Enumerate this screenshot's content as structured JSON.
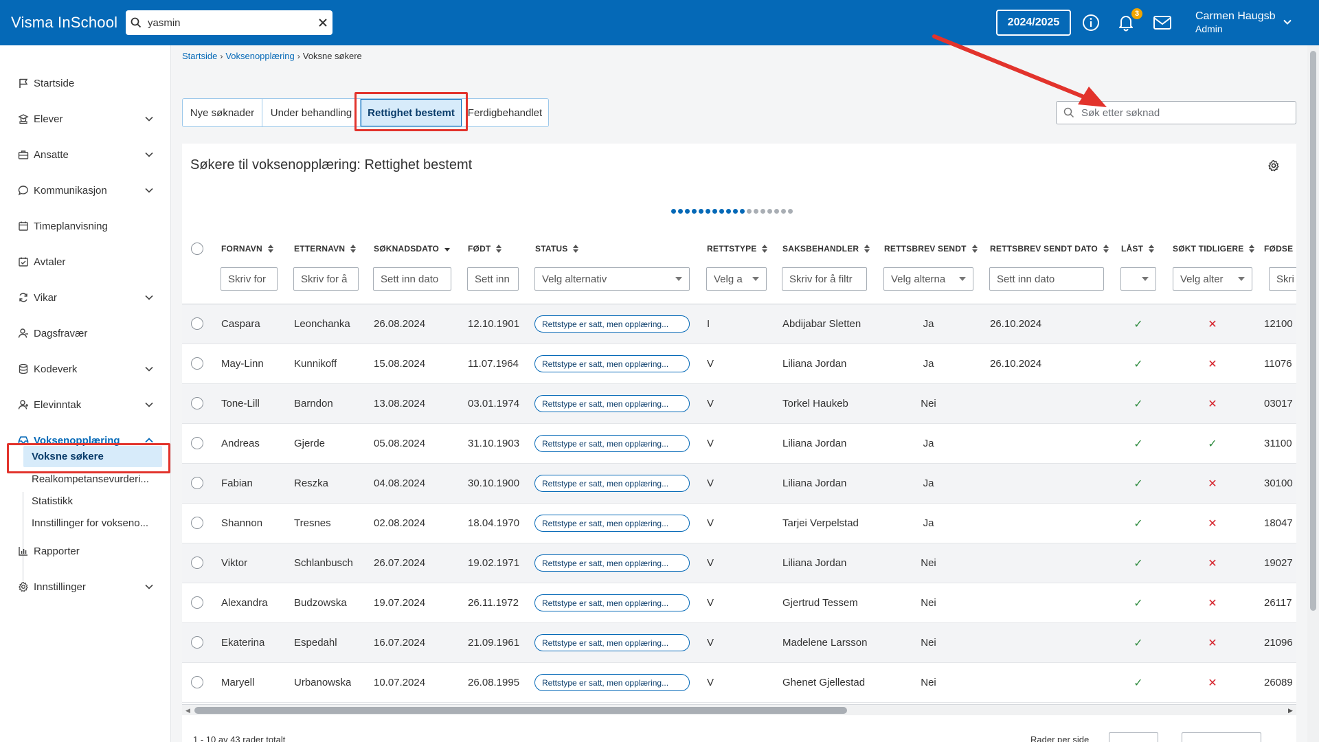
{
  "app": {
    "title": "Visma InSchool"
  },
  "global_search": {
    "value": "yasmin",
    "icon": "search-icon",
    "clear_icon": "close-icon"
  },
  "header": {
    "school_year": "2024/2025",
    "notifications_count": "3",
    "user_name": "Carmen Haugsb",
    "user_role": "Admin"
  },
  "sidebar": {
    "items": [
      {
        "label": "Startside",
        "icon": "flag-icon"
      },
      {
        "label": "Elever",
        "icon": "students-icon"
      },
      {
        "label": "Ansatte",
        "icon": "briefcase-icon"
      },
      {
        "label": "Kommunikasjon",
        "icon": "chat-icon"
      },
      {
        "label": "Timeplanvisning",
        "icon": "calendar-icon"
      },
      {
        "label": "Avtaler",
        "icon": "calendar-check-icon"
      },
      {
        "label": "Vikar",
        "icon": "swap-icon"
      },
      {
        "label": "Dagsfravær",
        "icon": "person-icon"
      },
      {
        "label": "Kodeverk",
        "icon": "database-icon"
      },
      {
        "label": "Elevinntak",
        "icon": "person-add-icon"
      },
      {
        "label": "Voksenopplæring",
        "icon": "inbox-icon"
      },
      {
        "label": "Rapporter",
        "icon": "chart-icon"
      },
      {
        "label": "Innstillinger",
        "icon": "gear-icon"
      }
    ],
    "subitems": [
      {
        "label": "Voksne søkere"
      },
      {
        "label": "Realkompetansevurderi..."
      },
      {
        "label": "Statistikk"
      },
      {
        "label": "Innstillinger for voksenо..."
      }
    ]
  },
  "breadcrumb": {
    "items": [
      "Startside",
      "Voksenopplæring"
    ],
    "current": "Voksne søkere"
  },
  "tabs": [
    "Nye søknader",
    "Under behandling",
    "Rettighet bestemt",
    "Ferdigbehandlet"
  ],
  "app_search": {
    "placeholder": "Søk etter søknad"
  },
  "card": {
    "title": "Søkere til voksenopplæring: Rettighet bestemt"
  },
  "table": {
    "columns": [
      "FORNAVN",
      "ETTERNAVN",
      "SØKNADSDATO",
      "FØDT",
      "STATUS",
      "RETTSTYPE",
      "SAKSBEHANDLER",
      "RETTSBREV SENDT",
      "RETTSBREV SENDT DATO",
      "LÅST",
      "SØKT TIDLIGERE",
      "FØDSE"
    ],
    "filters": [
      "Skriv for",
      "Skriv for å",
      "Sett inn dato",
      "Sett inn",
      "Velg alternativ",
      "Velg a",
      "Skriv for å filtr",
      "Velg alterna",
      "Sett inn dato",
      "",
      "Velg alter",
      "Skri"
    ],
    "rows": [
      {
        "fornavn": "Caspara",
        "etternavn": "Leonchanka",
        "soknadsdato": "26.08.2024",
        "fodt": "12.10.1901",
        "status": "Rettstype er satt, men opplæring...",
        "rettstype": "I",
        "saksbehandler": "Abdijabar Sletten",
        "rettsbrev_sendt": "Ja",
        "rettsbrev_dato": "26.10.2024",
        "last": "check",
        "sokt": "cross",
        "fodsel": "12100"
      },
      {
        "fornavn": "May-Linn",
        "etternavn": "Kunnikoff",
        "soknadsdato": "15.08.2024",
        "fodt": "11.07.1964",
        "status": "Rettstype er satt, men opplæring...",
        "rettstype": "V",
        "saksbehandler": "Liliana Jordan",
        "rettsbrev_sendt": "Ja",
        "rettsbrev_dato": "26.10.2024",
        "last": "check",
        "sokt": "cross",
        "fodsel": "11076"
      },
      {
        "fornavn": "Tone-Lill",
        "etternavn": "Barndon",
        "soknadsdato": "13.08.2024",
        "fodt": "03.01.1974",
        "status": "Rettstype er satt, men opplæring...",
        "rettstype": "V",
        "saksbehandler": "Torkel Haukeb",
        "rettsbrev_sendt": "Nei",
        "rettsbrev_dato": "",
        "last": "check",
        "sokt": "cross",
        "fodsel": "03017"
      },
      {
        "fornavn": "Andreas",
        "etternavn": "Gjerde",
        "soknadsdato": "05.08.2024",
        "fodt": "31.10.1903",
        "status": "Rettstype er satt, men opplæring...",
        "rettstype": "V",
        "saksbehandler": "Liliana Jordan",
        "rettsbrev_sendt": "Ja",
        "rettsbrev_dato": "",
        "last": "check",
        "sokt": "check",
        "fodsel": "31100"
      },
      {
        "fornavn": "Fabian",
        "etternavn": "Reszka",
        "soknadsdato": "04.08.2024",
        "fodt": "30.10.1900",
        "status": "Rettstype er satt, men opplæring...",
        "rettstype": "V",
        "saksbehandler": "Liliana Jordan",
        "rettsbrev_sendt": "Ja",
        "rettsbrev_dato": "",
        "last": "check",
        "sokt": "cross",
        "fodsel": "30100"
      },
      {
        "fornavn": "Shannon",
        "etternavn": "Tresnes",
        "soknadsdato": "02.08.2024",
        "fodt": "18.04.1970",
        "status": "Rettstype er satt, men opplæring...",
        "rettstype": "V",
        "saksbehandler": "Tarjei Verpelstad",
        "rettsbrev_sendt": "Ja",
        "rettsbrev_dato": "",
        "last": "check",
        "sokt": "cross",
        "fodsel": "18047"
      },
      {
        "fornavn": "Viktor",
        "etternavn": "Schlanbusch",
        "soknadsdato": "26.07.2024",
        "fodt": "19.02.1971",
        "status": "Rettstype er satt, men opplæring...",
        "rettstype": "V",
        "saksbehandler": "Liliana Jordan",
        "rettsbrev_sendt": "Nei",
        "rettsbrev_dato": "",
        "last": "check",
        "sokt": "cross",
        "fodsel": "19027"
      },
      {
        "fornavn": "Alexandra",
        "etternavn": "Budzowska",
        "soknadsdato": "19.07.2024",
        "fodt": "26.11.1972",
        "status": "Rettstype er satt, men opplæring...",
        "rettstype": "V",
        "saksbehandler": "Gjertrud Tessem",
        "rettsbrev_sendt": "Nei",
        "rettsbrev_dato": "",
        "last": "check",
        "sokt": "cross",
        "fodsel": "26117"
      },
      {
        "fornavn": "Ekaterina",
        "etternavn": "Espedahl",
        "soknadsdato": "16.07.2024",
        "fodt": "21.09.1961",
        "status": "Rettstype er satt, men opplæring...",
        "rettstype": "V",
        "saksbehandler": "Madelene Larsson",
        "rettsbrev_sendt": "Nei",
        "rettsbrev_dato": "",
        "last": "check",
        "sokt": "cross",
        "fodsel": "21096"
      },
      {
        "fornavn": "Maryell",
        "etternavn": "Urbanowska",
        "soknadsdato": "10.07.2024",
        "fodt": "26.08.1995",
        "status": "Rettstype er satt, men opplæring...",
        "rettstype": "V",
        "saksbehandler": "Ghenet Gjellestad",
        "rettsbrev_sendt": "Nei",
        "rettsbrev_dato": "",
        "last": "check",
        "sokt": "cross",
        "fodsel": "26089"
      }
    ]
  },
  "footer": {
    "total": "1 - 10 av 43 rader totalt",
    "rows_per_page": "Rader per side"
  },
  "colors": {
    "brand": "#0569b7",
    "highlight": "#e2332c",
    "check": "#2e8b3e",
    "cross": "#d6262f"
  }
}
